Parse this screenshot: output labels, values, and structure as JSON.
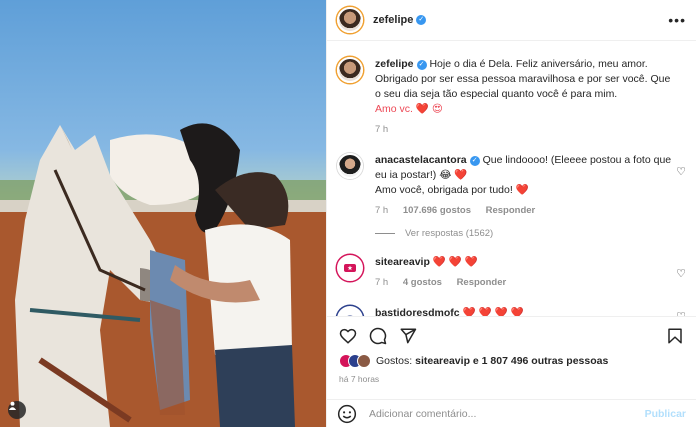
{
  "post": {
    "author": "zefelipe",
    "more_icon": "more-horizontal-icon"
  },
  "caption": {
    "username": "zefelipe",
    "text": "Hoje o dia é Dela. Feliz aniversário, meu amor. Obrigado por ser essa pessoa maravilhosa e por ser você. Que o seu dia seja tão especial quanto você é para mim.",
    "sign_off": "Amo vc. ❤️ 😍",
    "time": "7 h"
  },
  "comments": [
    {
      "username": "anacastelacantora",
      "text": "Que lindoooo! (Eleeee postou a foto que eu ia postar!) 😂 ❤️",
      "line2": "Amo você, obrigada por tudo! ❤️",
      "time": "7 h",
      "likes": "107.696 gostos",
      "reply": "Responder",
      "view_replies": "Ver respostas (1562)"
    },
    {
      "username": "siteareavip",
      "text": "❤️ ❤️ ❤️",
      "time": "7 h",
      "likes": "4 gostos",
      "reply": "Responder"
    },
    {
      "username": "bastidoresdmofc",
      "text": "❤️ ❤️ ❤️ ❤️"
    }
  ],
  "likes": {
    "label": "Gostos:",
    "first_user": "siteareavip",
    "rest": "e 1 807 496 outras pessoas"
  },
  "posted_ago": "há 7 horas",
  "composer": {
    "placeholder": "Adicionar comentário...",
    "publish": "Publicar"
  },
  "colors": {
    "verified": "#3897f0",
    "heart": "#ed4956",
    "publish_disabled": "#b2dffc",
    "muted": "#8e8e8e"
  }
}
